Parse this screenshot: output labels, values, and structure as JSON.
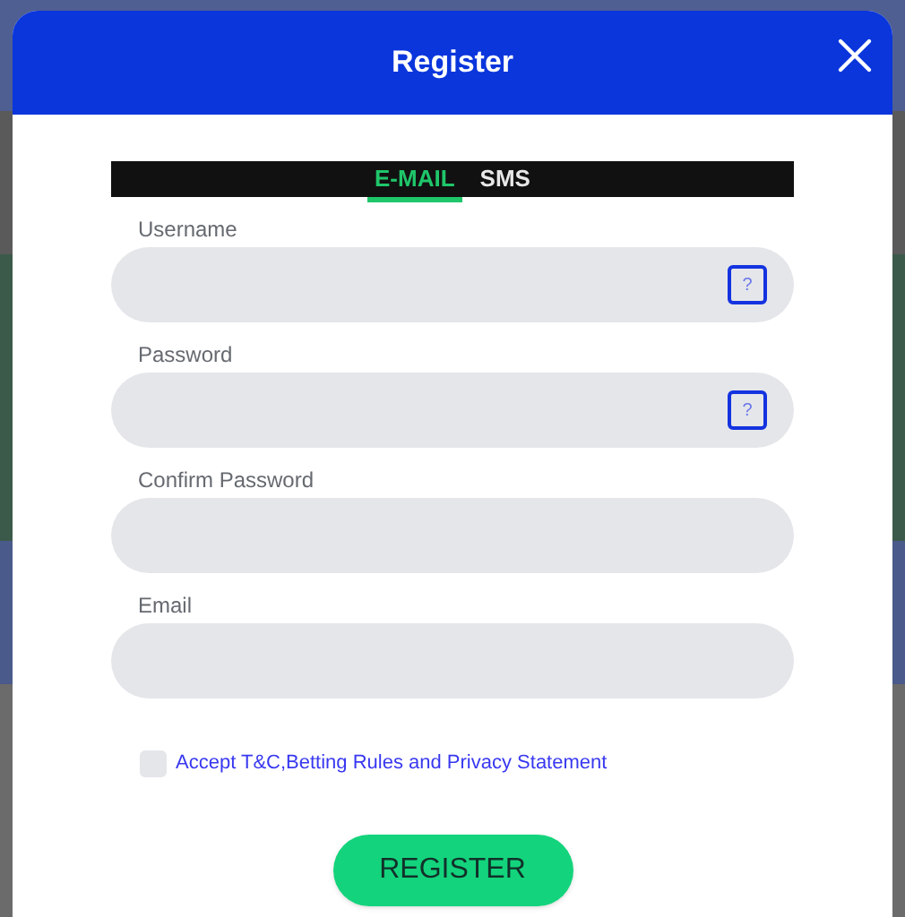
{
  "dialog": {
    "title": "Register"
  },
  "tabs": [
    {
      "label": "E-MAIL",
      "selected": true
    },
    {
      "label": "SMS",
      "selected": false
    }
  ],
  "fields": [
    {
      "label": "Username",
      "help": "?"
    },
    {
      "label": "Password",
      "help": "?"
    },
    {
      "label": "Confirm Password"
    },
    {
      "label": "Email"
    }
  ],
  "agreement": {
    "label": "Accept T&C,Betting Rules and Privacy Statement",
    "checked": false
  },
  "submit": "REGISTER"
}
